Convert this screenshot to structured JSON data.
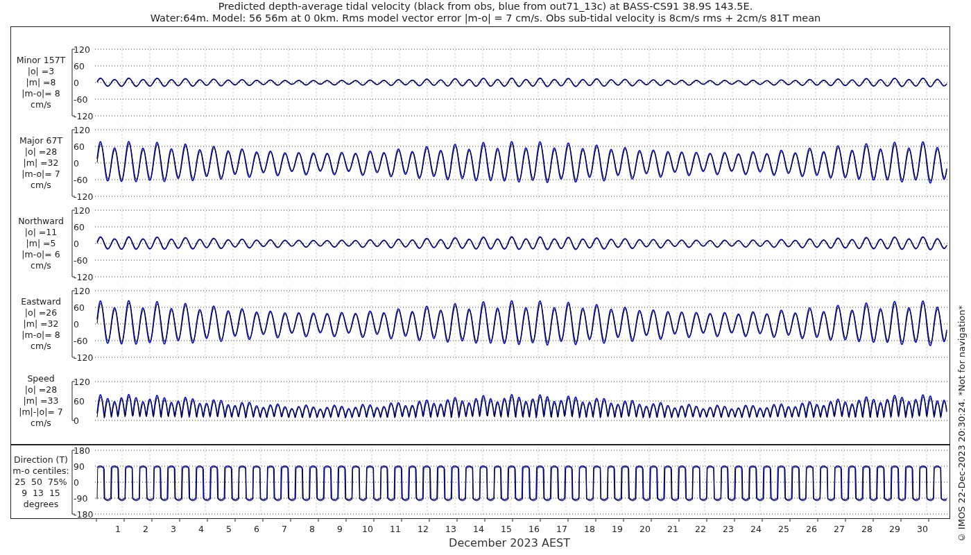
{
  "title": [
    "Predicted depth-average tidal velocity (black from obs, blue from out71_13c) at BASS-CS91 38.9S 143.5E.",
    "Water:64m. Model: 56 56m at 0 0km. Rms model vector error |m-o| = 7 cm/s. Obs sub-tidal velocity is 8cm/s rms + 2cm/s 81T mean"
  ],
  "panels": [
    {
      "kind": "component",
      "label": [
        "Minor 157T",
        "|o| =3",
        "|m| =8",
        "|m-o|= 8",
        "cm/s"
      ],
      "yticks": [
        "120",
        "60",
        "0",
        "-60",
        "-120"
      ]
    },
    {
      "kind": "component",
      "label": [
        "Major 67T",
        "|o| =28",
        "|m| =32",
        "|m-o|= 7",
        "cm/s"
      ],
      "yticks": [
        "120",
        "60",
        "0",
        "-60",
        "-120"
      ]
    },
    {
      "kind": "component",
      "label": [
        "Northward",
        "|o| =11",
        "|m| =5",
        "|m-o|= 6",
        "cm/s"
      ],
      "yticks": [
        "120",
        "60",
        "0",
        "-60",
        "-120"
      ]
    },
    {
      "kind": "component",
      "label": [
        "Eastward",
        "|o| =26",
        "|m| =32",
        "|m-o|= 8",
        "cm/s"
      ],
      "yticks": [
        "120",
        "60",
        "0",
        "-60",
        "-120"
      ]
    },
    {
      "kind": "speed",
      "label": [
        "Speed",
        "|o| =28",
        "|m| =33",
        "|m|-|o|= 7",
        "cm/s"
      ],
      "yticks": [
        "120",
        "60",
        "0"
      ]
    },
    {
      "kind": "direction",
      "label": [
        "Direction (T)",
        "m-o centiles:",
        "25  50  75%",
        "9  13  15",
        "degrees"
      ],
      "yticks": [
        "180",
        "90",
        "0",
        "-90",
        "-180"
      ]
    }
  ],
  "xaxis": {
    "ticks": [
      "1",
      "2",
      "3",
      "4",
      "5",
      "6",
      "7",
      "8",
      "9",
      "10",
      "11",
      "12",
      "13",
      "14",
      "15",
      "16",
      "17",
      "18",
      "19",
      "20",
      "21",
      "22",
      "23",
      "24",
      "25",
      "26",
      "27",
      "28",
      "29",
      "30"
    ],
    "label": "December 2023 AEST"
  },
  "credit": "© IMOS 22-Dec-2023 20:30:24. *Not for navigation*"
}
